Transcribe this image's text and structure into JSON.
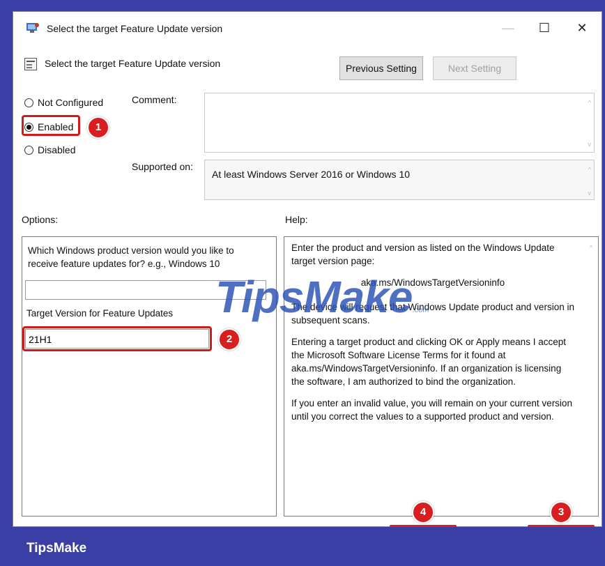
{
  "dialog": {
    "title": "Select the target Feature Update version",
    "setting_title": "Select the target Feature Update version",
    "window_controls": {
      "minimize": "—",
      "maximize": "☐",
      "close": "✕"
    }
  },
  "buttons": {
    "previous": "Previous Setting",
    "next": "Next Setting"
  },
  "state": {
    "options": [
      "Not Configured",
      "Enabled",
      "Disabled"
    ],
    "selected": "Enabled"
  },
  "labels": {
    "comment": "Comment:",
    "supported_on": "Supported on:",
    "options": "Options:",
    "help": "Help:"
  },
  "supported_on_value": "At least Windows Server 2016 or Windows 10",
  "options_panel": {
    "question": "Which Windows product version would you like to receive feature updates for? e.g., Windows 10",
    "product_value": "",
    "target_label": "Target Version for Feature Updates",
    "target_value": "21H1"
  },
  "help_panel": {
    "p1": "Enter the product and version as listed on the Windows Update target version page:",
    "link": "aka.ms/WindowsTargetVersioninfo",
    "p2": "The device will request that Windows Update product and version in subsequent scans.",
    "p3": "Entering a target product and clicking OK or Apply means I accept the Microsoft Software License Terms for it found at aka.ms/WindowsTargetVersioninfo. If an organization is licensing the software, I am authorized to bind the organization.",
    "p4": "If you enter an invalid value, you will remain on your current version until you correct the values to a supported product and version."
  },
  "annotations": [
    "1",
    "2",
    "3",
    "4"
  ],
  "watermark": {
    "main": "TipsMake",
    "suffix": ".com"
  },
  "brand": "TipsMake",
  "colors": {
    "accent_red": "#d81e1e",
    "frame_blue": "#3a3fa6",
    "watermark_blue": "#2850b4"
  }
}
